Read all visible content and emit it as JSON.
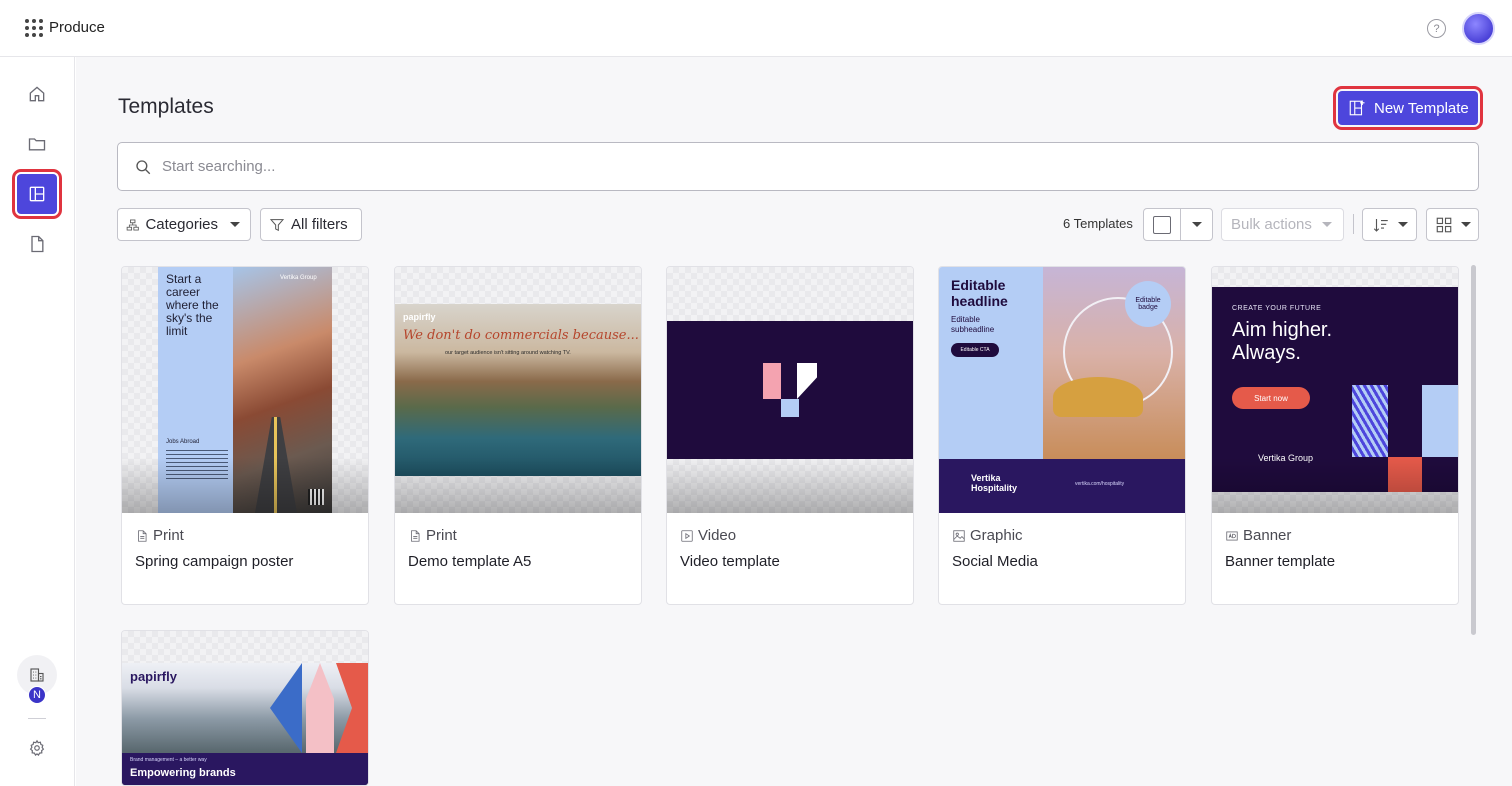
{
  "topbar": {
    "app_name": "Produce",
    "help_glyph": "?"
  },
  "sidebar": {
    "items": [
      {
        "name": "home-icon"
      },
      {
        "name": "folder-icon"
      },
      {
        "name": "templates-icon",
        "active": true
      },
      {
        "name": "document-icon"
      }
    ],
    "org_badge": "N"
  },
  "main": {
    "title": "Templates",
    "new_template_label": "New Template",
    "search_placeholder": "Start searching...",
    "categories_label": "Categories",
    "filters_label": "All filters",
    "count_label": "6 Templates",
    "bulk_label": "Bulk actions"
  },
  "cards": [
    {
      "type": "Print",
      "name": "Spring campaign poster",
      "art": {
        "headline": "Start a career where the sky's the limit",
        "brand": "Vertika Group",
        "section": "Jobs Abroad"
      }
    },
    {
      "type": "Print",
      "name": "Demo template A5",
      "art": {
        "brand": "papirfly",
        "headline": "We don't do commercials because...",
        "sub": "our target audience isn't sitting around watching TV."
      }
    },
    {
      "type": "Video",
      "name": "Video template",
      "art": {}
    },
    {
      "type": "Graphic",
      "name": "Social Media",
      "art": {
        "headline": "Editable headline",
        "sub": "Editable subheadline",
        "cta": "Editable CTA",
        "badge": "Editable badge",
        "brand": "Vertika Hospitality",
        "url": "vertika.com/hospitality"
      }
    },
    {
      "type": "Banner",
      "name": "Banner template",
      "art": {
        "kicker": "CREATE YOUR FUTURE",
        "headline": "Aim higher. Always.",
        "cta": "Start now",
        "brand": "Vertika Group"
      }
    },
    {
      "type": "",
      "name": "",
      "art": {
        "brand": "papirfly",
        "kicker": "Brand management – a better way",
        "headline": "Empowering brands"
      }
    }
  ],
  "colors": {
    "accent": "#4d46dc",
    "highlight": "#e0343f",
    "dark_purple": "#1f0b3d"
  }
}
